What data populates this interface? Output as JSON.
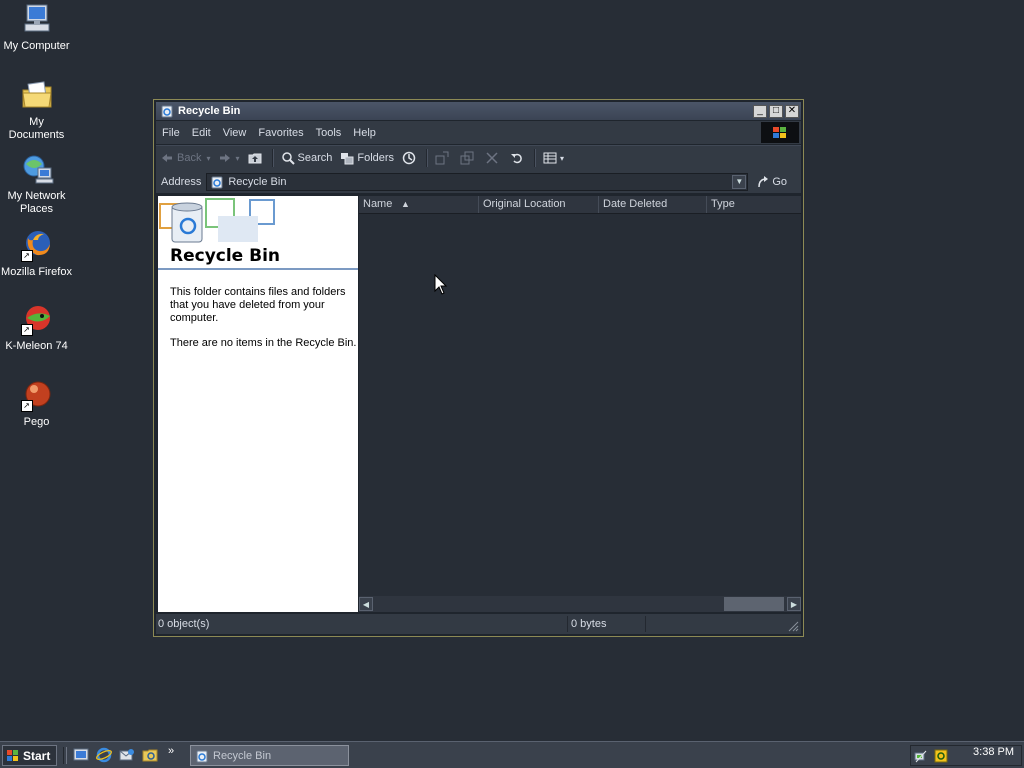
{
  "desktop": {
    "icons": [
      {
        "label": "My Computer",
        "icon": "computer-icon"
      },
      {
        "label": "My Documents",
        "icon": "documents-folder-icon"
      },
      {
        "label": "My Network Places",
        "icon": "network-icon"
      },
      {
        "label": "Mozilla Firefox",
        "icon": "firefox-icon"
      },
      {
        "label": "K-Meleon 74",
        "icon": "k-meleon-icon"
      },
      {
        "label": "Pego",
        "icon": "pego-icon"
      }
    ]
  },
  "window": {
    "title": "Recycle Bin",
    "menu": [
      "File",
      "Edit",
      "View",
      "Favorites",
      "Tools",
      "Help"
    ],
    "toolbar": {
      "back": "Back",
      "search": "Search",
      "folders": "Folders"
    },
    "address": {
      "label": "Address",
      "value": "Recycle Bin",
      "go": "Go"
    },
    "taskpane": {
      "title": "Recycle Bin",
      "description": "This folder contains files and folders that you have deleted from your computer.",
      "empty_message": "There are no items in the Recycle Bin."
    },
    "columns": [
      "Name",
      "Original Location",
      "Date Deleted",
      "Type"
    ],
    "status": {
      "objects": "0 object(s)",
      "size": "0 bytes"
    }
  },
  "taskbar": {
    "start": "Start",
    "quick_launch_more": "»",
    "task": "Recycle Bin",
    "clock": "3:38 PM"
  },
  "colors": {
    "desktop": "#272d36",
    "window_border": "#8d8a55",
    "titlebar": "#4b5668",
    "pane_accent": "#7c9ac2"
  }
}
